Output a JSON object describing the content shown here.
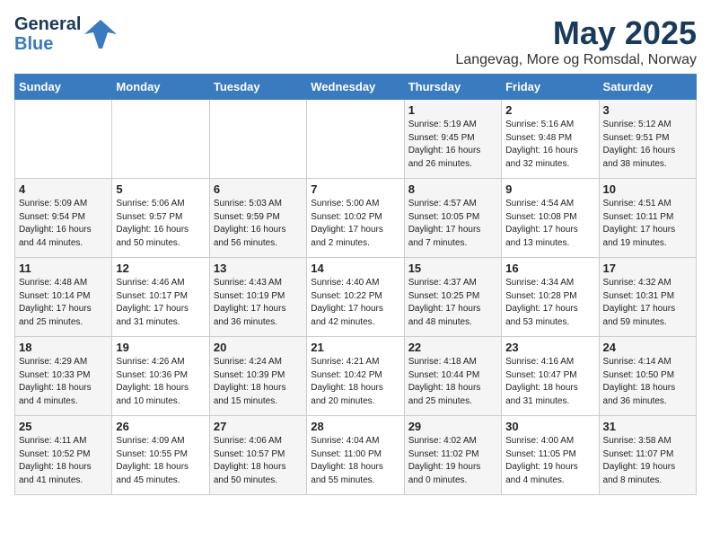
{
  "header": {
    "logo_general": "General",
    "logo_blue": "Blue",
    "month_title": "May 2025",
    "location": "Langevag, More og Romsdal, Norway"
  },
  "days_of_week": [
    "Sunday",
    "Monday",
    "Tuesday",
    "Wednesday",
    "Thursday",
    "Friday",
    "Saturday"
  ],
  "weeks": [
    [
      {
        "day": "",
        "info": ""
      },
      {
        "day": "",
        "info": ""
      },
      {
        "day": "",
        "info": ""
      },
      {
        "day": "",
        "info": ""
      },
      {
        "day": "1",
        "info": "Sunrise: 5:19 AM\nSunset: 9:45 PM\nDaylight: 16 hours\nand 26 minutes."
      },
      {
        "day": "2",
        "info": "Sunrise: 5:16 AM\nSunset: 9:48 PM\nDaylight: 16 hours\nand 32 minutes."
      },
      {
        "day": "3",
        "info": "Sunrise: 5:12 AM\nSunset: 9:51 PM\nDaylight: 16 hours\nand 38 minutes."
      }
    ],
    [
      {
        "day": "4",
        "info": "Sunrise: 5:09 AM\nSunset: 9:54 PM\nDaylight: 16 hours\nand 44 minutes."
      },
      {
        "day": "5",
        "info": "Sunrise: 5:06 AM\nSunset: 9:57 PM\nDaylight: 16 hours\nand 50 minutes."
      },
      {
        "day": "6",
        "info": "Sunrise: 5:03 AM\nSunset: 9:59 PM\nDaylight: 16 hours\nand 56 minutes."
      },
      {
        "day": "7",
        "info": "Sunrise: 5:00 AM\nSunset: 10:02 PM\nDaylight: 17 hours\nand 2 minutes."
      },
      {
        "day": "8",
        "info": "Sunrise: 4:57 AM\nSunset: 10:05 PM\nDaylight: 17 hours\nand 7 minutes."
      },
      {
        "day": "9",
        "info": "Sunrise: 4:54 AM\nSunset: 10:08 PM\nDaylight: 17 hours\nand 13 minutes."
      },
      {
        "day": "10",
        "info": "Sunrise: 4:51 AM\nSunset: 10:11 PM\nDaylight: 17 hours\nand 19 minutes."
      }
    ],
    [
      {
        "day": "11",
        "info": "Sunrise: 4:48 AM\nSunset: 10:14 PM\nDaylight: 17 hours\nand 25 minutes."
      },
      {
        "day": "12",
        "info": "Sunrise: 4:46 AM\nSunset: 10:17 PM\nDaylight: 17 hours\nand 31 minutes."
      },
      {
        "day": "13",
        "info": "Sunrise: 4:43 AM\nSunset: 10:19 PM\nDaylight: 17 hours\nand 36 minutes."
      },
      {
        "day": "14",
        "info": "Sunrise: 4:40 AM\nSunset: 10:22 PM\nDaylight: 17 hours\nand 42 minutes."
      },
      {
        "day": "15",
        "info": "Sunrise: 4:37 AM\nSunset: 10:25 PM\nDaylight: 17 hours\nand 48 minutes."
      },
      {
        "day": "16",
        "info": "Sunrise: 4:34 AM\nSunset: 10:28 PM\nDaylight: 17 hours\nand 53 minutes."
      },
      {
        "day": "17",
        "info": "Sunrise: 4:32 AM\nSunset: 10:31 PM\nDaylight: 17 hours\nand 59 minutes."
      }
    ],
    [
      {
        "day": "18",
        "info": "Sunrise: 4:29 AM\nSunset: 10:33 PM\nDaylight: 18 hours\nand 4 minutes."
      },
      {
        "day": "19",
        "info": "Sunrise: 4:26 AM\nSunset: 10:36 PM\nDaylight: 18 hours\nand 10 minutes."
      },
      {
        "day": "20",
        "info": "Sunrise: 4:24 AM\nSunset: 10:39 PM\nDaylight: 18 hours\nand 15 minutes."
      },
      {
        "day": "21",
        "info": "Sunrise: 4:21 AM\nSunset: 10:42 PM\nDaylight: 18 hours\nand 20 minutes."
      },
      {
        "day": "22",
        "info": "Sunrise: 4:18 AM\nSunset: 10:44 PM\nDaylight: 18 hours\nand 25 minutes."
      },
      {
        "day": "23",
        "info": "Sunrise: 4:16 AM\nSunset: 10:47 PM\nDaylight: 18 hours\nand 31 minutes."
      },
      {
        "day": "24",
        "info": "Sunrise: 4:14 AM\nSunset: 10:50 PM\nDaylight: 18 hours\nand 36 minutes."
      }
    ],
    [
      {
        "day": "25",
        "info": "Sunrise: 4:11 AM\nSunset: 10:52 PM\nDaylight: 18 hours\nand 41 minutes."
      },
      {
        "day": "26",
        "info": "Sunrise: 4:09 AM\nSunset: 10:55 PM\nDaylight: 18 hours\nand 45 minutes."
      },
      {
        "day": "27",
        "info": "Sunrise: 4:06 AM\nSunset: 10:57 PM\nDaylight: 18 hours\nand 50 minutes."
      },
      {
        "day": "28",
        "info": "Sunrise: 4:04 AM\nSunset: 11:00 PM\nDaylight: 18 hours\nand 55 minutes."
      },
      {
        "day": "29",
        "info": "Sunrise: 4:02 AM\nSunset: 11:02 PM\nDaylight: 19 hours\nand 0 minutes."
      },
      {
        "day": "30",
        "info": "Sunrise: 4:00 AM\nSunset: 11:05 PM\nDaylight: 19 hours\nand 4 minutes."
      },
      {
        "day": "31",
        "info": "Sunrise: 3:58 AM\nSunset: 11:07 PM\nDaylight: 19 hours\nand 8 minutes."
      }
    ]
  ]
}
